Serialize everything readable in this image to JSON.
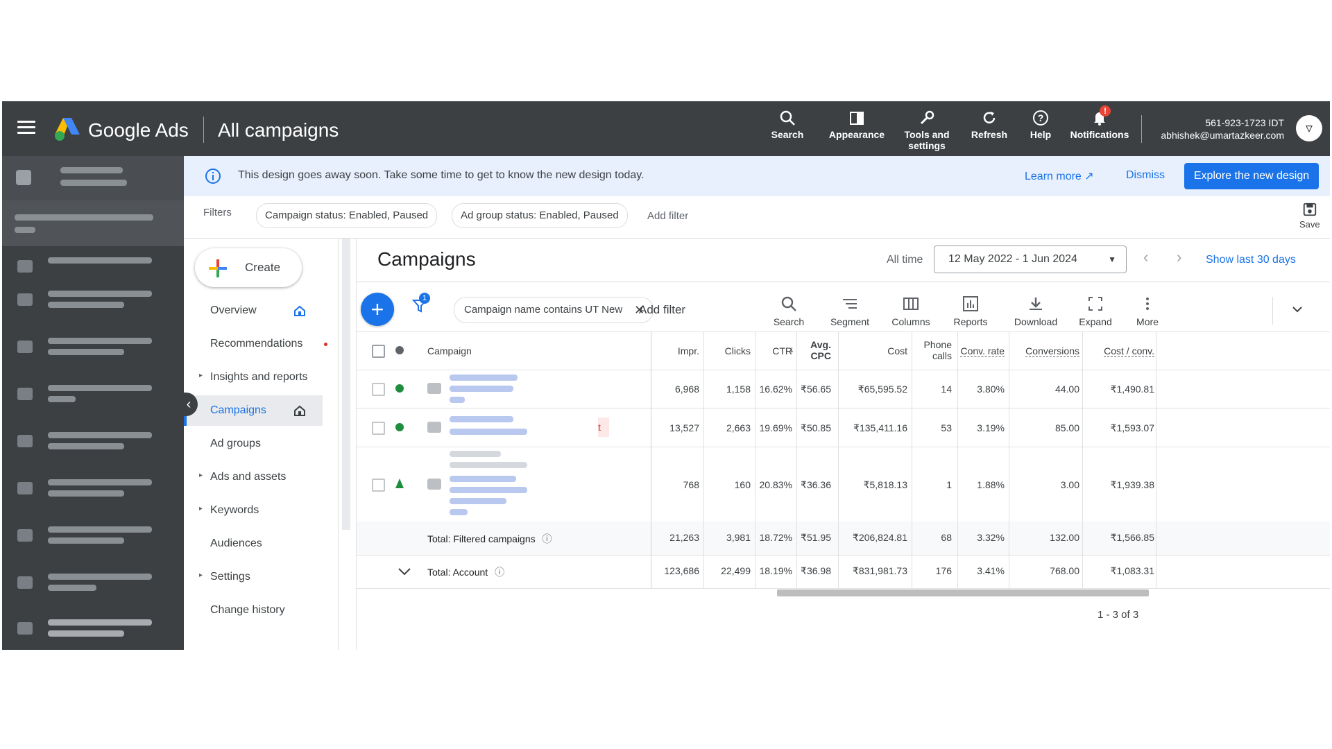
{
  "topbar": {
    "brand": "Google Ads",
    "page_title": "All campaigns",
    "buttons": [
      {
        "label": "Search",
        "icon": "search-icon"
      },
      {
        "label": "Appearance",
        "icon": "appearance-icon"
      },
      {
        "label": "Tools and\nsettings",
        "icon": "wrench-icon"
      },
      {
        "label": "Refresh",
        "icon": "refresh-icon"
      },
      {
        "label": "Help",
        "icon": "help-icon"
      },
      {
        "label": "Notifications",
        "icon": "bell-icon"
      }
    ],
    "notification_badge": "!",
    "account_id": "561-923-1723 IDT",
    "account_email": "abhishek@umartazkeer.com"
  },
  "banner": {
    "message": "This design goes away soon. Take some time to get to know the new design today.",
    "learn_more": "Learn more",
    "dismiss": "Dismiss",
    "explore": "Explore the new design"
  },
  "filters": {
    "label": "Filters",
    "chips": [
      "Campaign status: Enabled, Paused",
      "Ad group status: Enabled, Paused"
    ],
    "add_filter": "Add filter",
    "save": "Save"
  },
  "secnav": {
    "create": "Create",
    "items": [
      {
        "label": "Overview",
        "caret": false
      },
      {
        "label": "Recommendations",
        "caret": false
      },
      {
        "label": "Insights and reports",
        "caret": true
      },
      {
        "label": "Campaigns",
        "caret": false
      },
      {
        "label": "Ad groups",
        "caret": false
      },
      {
        "label": "Ads and assets",
        "caret": true
      },
      {
        "label": "Keywords",
        "caret": true
      },
      {
        "label": "Audiences",
        "caret": false
      },
      {
        "label": "Settings",
        "caret": true
      },
      {
        "label": "Change history",
        "caret": false
      }
    ]
  },
  "main": {
    "title": "Campaigns",
    "all_time": "All time",
    "date_range": "12 May 2022 - 1 Jun 2024",
    "show_last": "Show last 30 days",
    "filter_badge": "1",
    "filter_chip": "Campaign name contains UT New",
    "add_filter": "Add filter",
    "tools": [
      "Search",
      "Segment",
      "Columns",
      "Reports",
      "Download",
      "Expand",
      "More"
    ],
    "pager": "1 - 3 of 3"
  },
  "table": {
    "headers": {
      "campaign": "Campaign",
      "impr": "Impr.",
      "clicks": "Clicks",
      "ctr": "CTR",
      "avg_cpc": "Avg.\nCPC",
      "cost": "Cost",
      "phone_calls": "Phone\ncalls",
      "conv_rate": "Conv. rate",
      "conversions": "Conversions",
      "cost_conv": "Cost / conv."
    },
    "rows": [
      {
        "impr": "6,968",
        "clicks": "1,158",
        "ctr": "16.62%",
        "avg_cpc": "₹56.65",
        "cost": "₹65,595.52",
        "phone_calls": "14",
        "conv_rate": "3.80%",
        "conversions": "44.00",
        "cost_conv": "₹1,490.81"
      },
      {
        "impr": "13,527",
        "clicks": "2,663",
        "ctr": "19.69%",
        "avg_cpc": "₹50.85",
        "cost": "₹135,411.16",
        "phone_calls": "53",
        "conv_rate": "3.19%",
        "conversions": "85.00",
        "cost_conv": "₹1,593.07"
      },
      {
        "impr": "768",
        "clicks": "160",
        "ctr": "20.83%",
        "avg_cpc": "₹36.36",
        "cost": "₹5,818.13",
        "phone_calls": "1",
        "conv_rate": "1.88%",
        "conversions": "3.00",
        "cost_conv": "₹1,939.38"
      }
    ],
    "total_filtered": {
      "label": "Total: Filtered campaigns",
      "impr": "21,263",
      "clicks": "3,981",
      "ctr": "18.72%",
      "avg_cpc": "₹51.95",
      "cost": "₹206,824.81",
      "phone_calls": "68",
      "conv_rate": "3.32%",
      "conversions": "132.00",
      "cost_conv": "₹1,566.85"
    },
    "total_account": {
      "label": "Total: Account",
      "impr": "123,686",
      "clicks": "22,499",
      "ctr": "18.19%",
      "avg_cpc": "₹36.98",
      "cost": "₹831,981.73",
      "phone_calls": "176",
      "conv_rate": "3.41%",
      "conversions": "768.00",
      "cost_conv": "₹1,083.31"
    },
    "row2_flag": "t"
  },
  "colors": {
    "topbar": "#3c4043",
    "accent": "#1a73e8",
    "enabled": "#1e8e3e",
    "banner": "#e8f0fe"
  }
}
